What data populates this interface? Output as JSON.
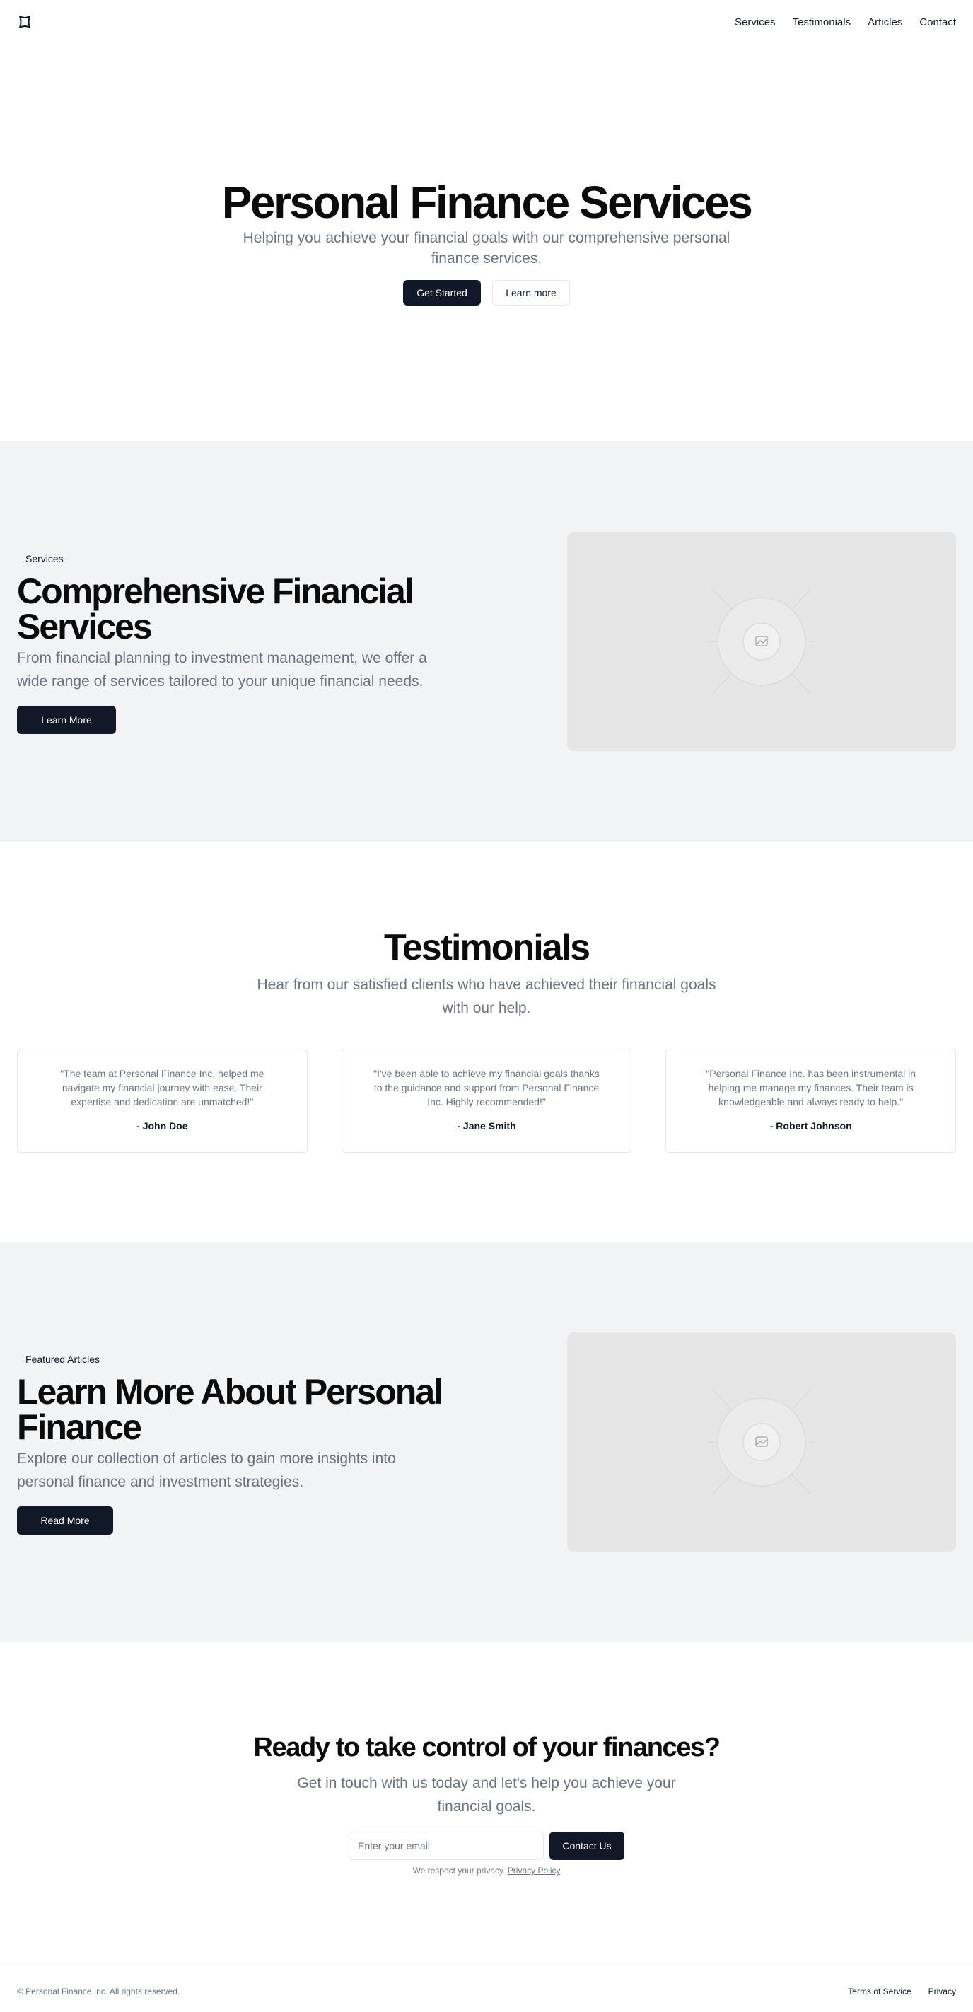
{
  "header": {
    "nav": [
      "Services",
      "Testimonials",
      "Articles",
      "Contact"
    ]
  },
  "hero": {
    "title": "Personal Finance Services",
    "subtitle": "Helping you achieve your financial goals with our comprehensive personal finance services.",
    "primary_button": "Get Started",
    "secondary_button": "Learn more"
  },
  "services": {
    "badge": "Services",
    "title": "Comprehensive Financial Services",
    "description": "From financial planning to investment management, we offer a wide range of services tailored to your unique financial needs.",
    "button": "Learn More"
  },
  "testimonials": {
    "title": "Testimonials",
    "subtitle": "Hear from our satisfied clients who have achieved their financial goals with our help.",
    "items": [
      {
        "quote": "\"The team at Personal Finance Inc. helped me navigate my financial journey with ease. Their expertise and dedication are unmatched!\"",
        "author": "- John Doe"
      },
      {
        "quote": "\"I've been able to achieve my financial goals thanks to the guidance and support from Personal Finance Inc. Highly recommended!\"",
        "author": "- Jane Smith"
      },
      {
        "quote": "\"Personal Finance Inc. has been instrumental in helping me manage my finances. Their team is knowledgeable and always ready to help.\"",
        "author": "- Robert Johnson"
      }
    ]
  },
  "articles": {
    "badge": "Featured Articles",
    "title": "Learn More About Personal Finance",
    "description": "Explore our collection of articles to gain more insights into personal finance and investment strategies.",
    "button": "Read More"
  },
  "cta": {
    "title": "Ready to take control of your finances?",
    "subtitle": "Get in touch with us today and let's help you achieve your financial goals.",
    "email_placeholder": "Enter your email",
    "button": "Contact Us",
    "note": "We respect your privacy.",
    "privacy_link": "Privacy Policy"
  },
  "footer": {
    "copyright": "© Personal Finance Inc. All rights reserved.",
    "links": [
      "Terms of Service",
      "Privacy"
    ]
  }
}
